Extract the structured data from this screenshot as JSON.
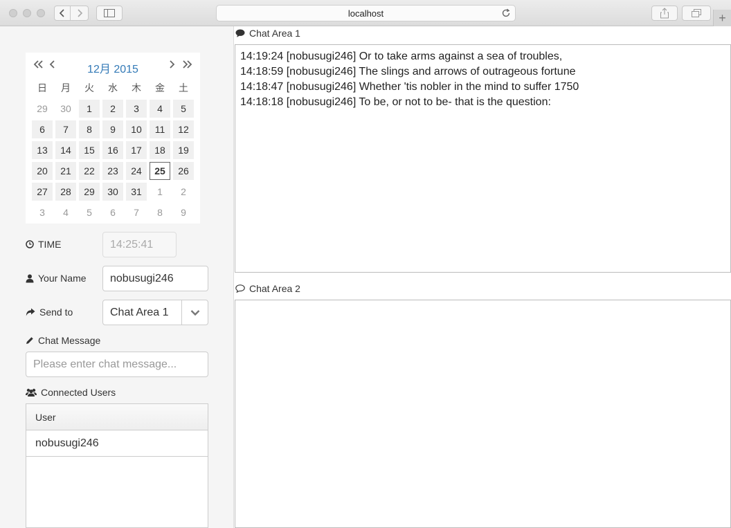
{
  "browser": {
    "url": "localhost"
  },
  "calendar": {
    "title": "12月 2015",
    "weekdays": [
      "日",
      "月",
      "火",
      "水",
      "木",
      "金",
      "土"
    ],
    "weeks": [
      [
        "29",
        "30",
        "1",
        "2",
        "3",
        "4",
        "5"
      ],
      [
        "6",
        "7",
        "8",
        "9",
        "10",
        "11",
        "12"
      ],
      [
        "13",
        "14",
        "15",
        "16",
        "17",
        "18",
        "19"
      ],
      [
        "20",
        "21",
        "22",
        "23",
        "24",
        "25",
        "26"
      ],
      [
        "27",
        "28",
        "29",
        "30",
        "31",
        "1",
        "2"
      ],
      [
        "3",
        "4",
        "5",
        "6",
        "7",
        "8",
        "9"
      ]
    ],
    "today": "25"
  },
  "form": {
    "time_label": "TIME",
    "time_value": "14:25:41",
    "name_label": "Your Name",
    "name_value": "nobusugi246",
    "sendto_label": "Send to",
    "sendto_value": "Chat Area 1",
    "message_label": "Chat Message",
    "message_placeholder": "Please enter chat message..."
  },
  "users": {
    "label": "Connected Users",
    "column": "User",
    "rows": [
      "nobusugi246"
    ]
  },
  "chat1": {
    "title": "Chat Area 1",
    "messages": [
      "14:19:24 [nobusugi246] Or to take arms against a sea of troubles,",
      "14:18:59 [nobusugi246] The slings and arrows of outrageous fortune",
      "14:18:47 [nobusugi246] Whether 'tis nobler in the mind to suffer 1750",
      "14:18:18 [nobusugi246] To be, or not to be- that is the question:"
    ]
  },
  "chat2": {
    "title": "Chat Area 2",
    "messages": []
  }
}
